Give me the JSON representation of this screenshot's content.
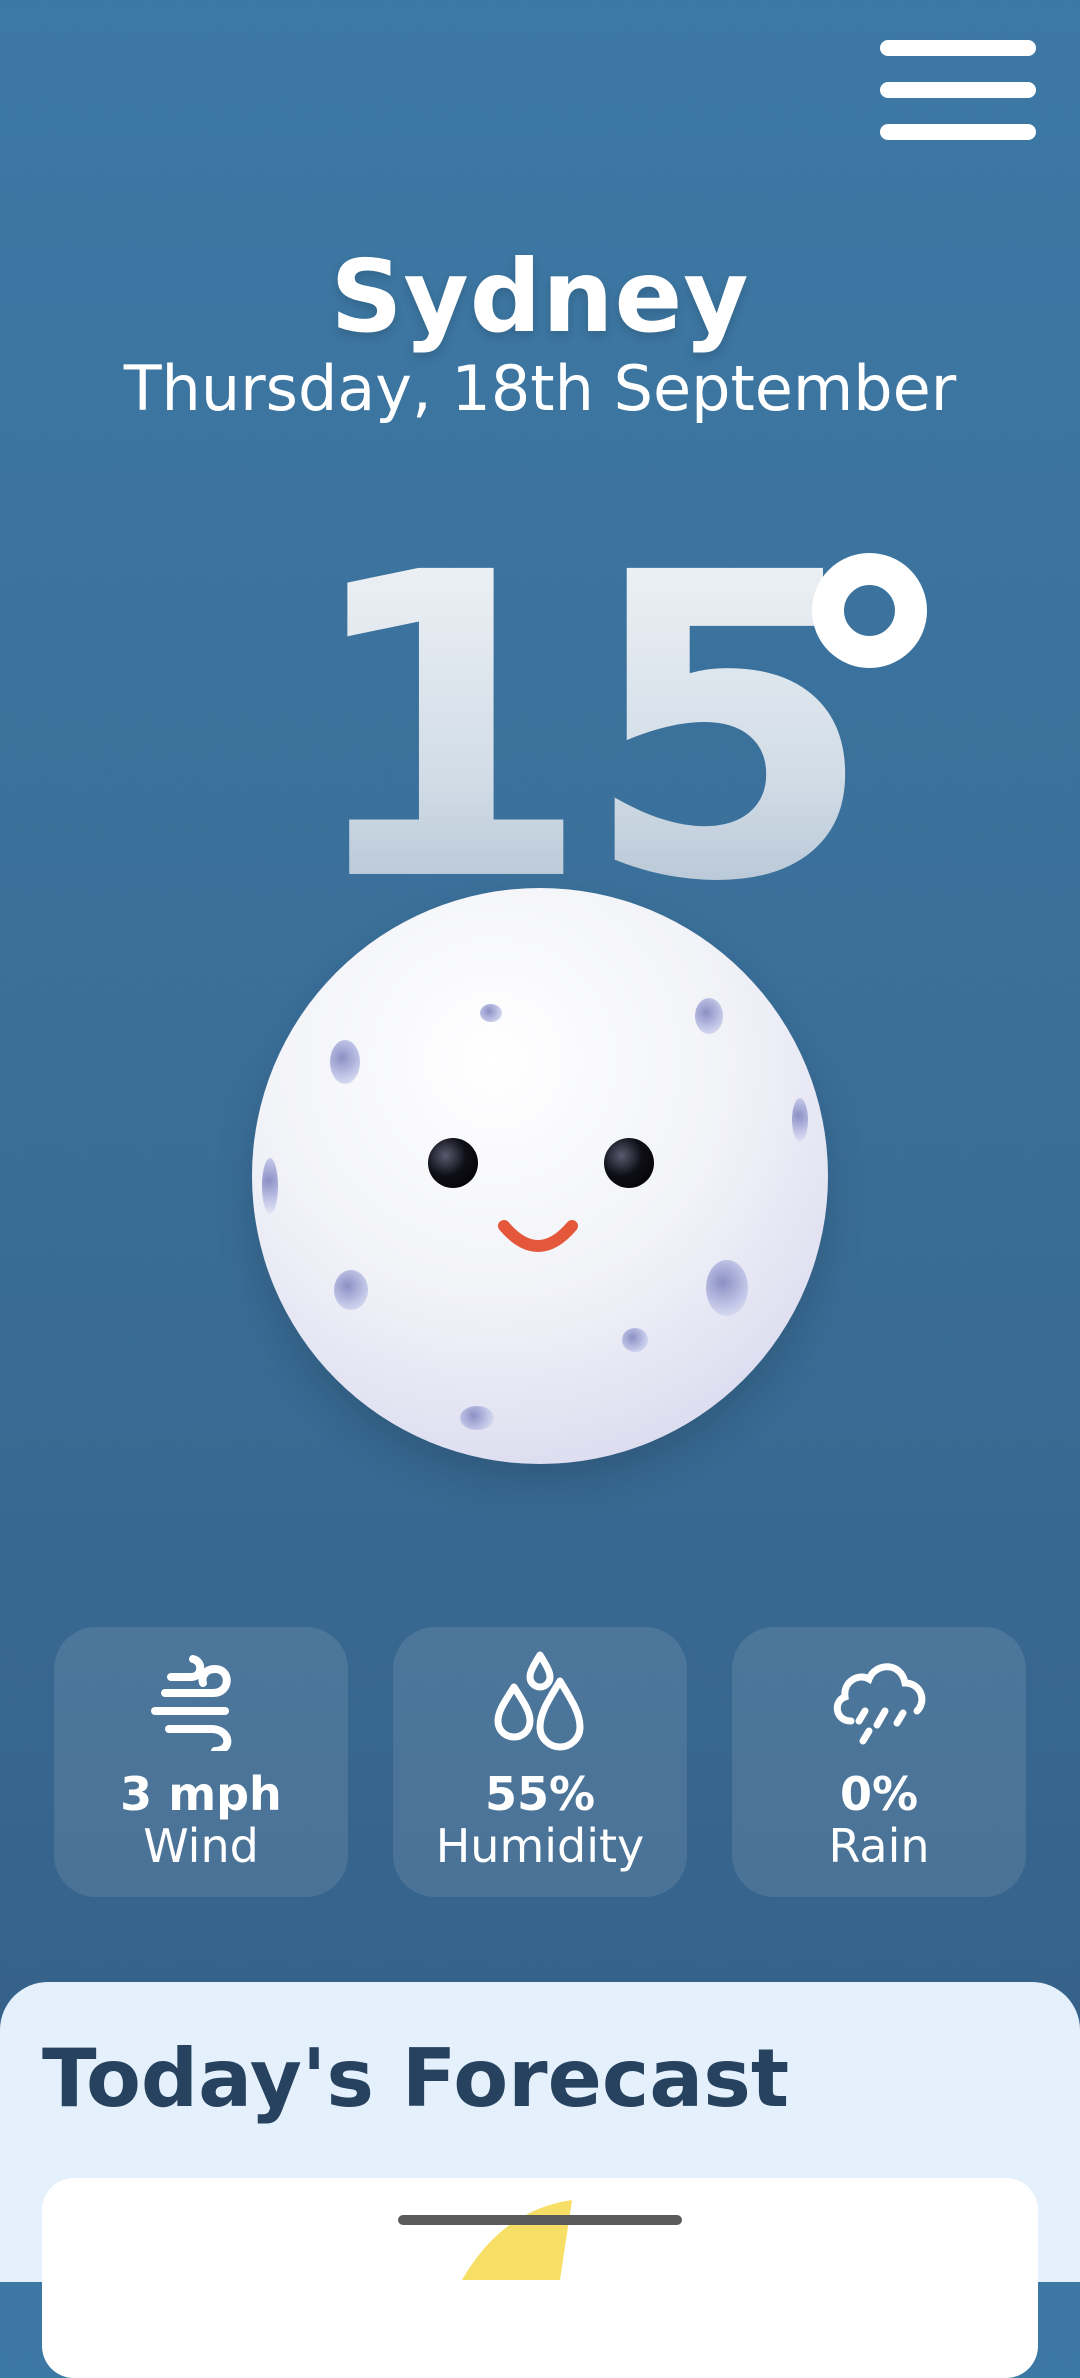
{
  "location": {
    "city": "Sydney",
    "date": "Thursday, 18th September"
  },
  "current": {
    "temperature": "15",
    "condition_icon": "moon-face-icon"
  },
  "stats": [
    {
      "icon": "wind-icon",
      "value": "3 mph",
      "label": "Wind"
    },
    {
      "icon": "humidity-drops-icon",
      "value": "55%",
      "label": "Humidity"
    },
    {
      "icon": "rain-cloud-icon",
      "value": "0%",
      "label": "Rain"
    }
  ],
  "forecast": {
    "title": "Today's Forecast"
  },
  "colors": {
    "background": "#3d79a5",
    "panel": "#e4f1fc",
    "title_text": "#26425f"
  }
}
